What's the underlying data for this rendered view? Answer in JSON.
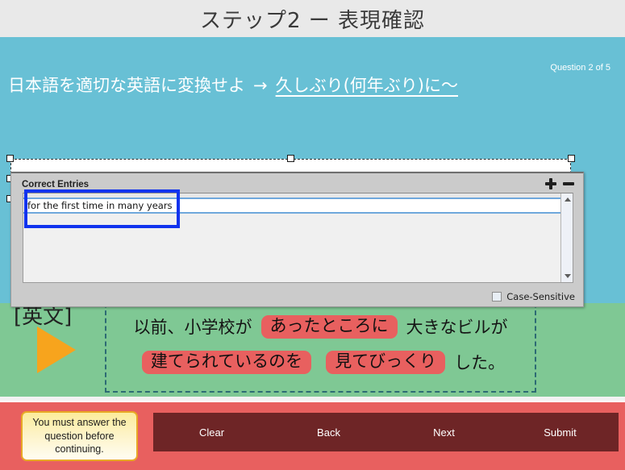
{
  "app": {
    "title": "ステップ2 ー 表現確認"
  },
  "question": {
    "counter": "Question 2 of 5",
    "instruction": "日本語を適切な英語に変換せよ",
    "arrow": "→",
    "target_phrase": "久しぶり(何年ぶり)に〜",
    "answer_value": "",
    "answer_placeholder": ""
  },
  "dialog": {
    "title": "Correct Entries",
    "add_label": "+",
    "remove_label": "−",
    "entries": [
      "for the first time in many years"
    ],
    "case_sensitive_label": "Case-Sensitive",
    "case_sensitive_checked": false,
    "scroll_up_icon": "triangle-up",
    "scroll_down_icon": "triangle-down"
  },
  "annotation": {
    "highlight_color": "#1133ee"
  },
  "sentence_panel": {
    "label": "[英文]",
    "play_icon": "play-triangle",
    "line1": [
      {
        "text": "以前、小学校が",
        "token": false
      },
      {
        "text": "あったところに",
        "token": true
      },
      {
        "text": "大きなビルが",
        "token": false
      }
    ],
    "line2": [
      {
        "text": "建てられているのを",
        "token": true
      },
      {
        "text": "見てびっくり",
        "token": true
      },
      {
        "text": "した。",
        "token": false
      }
    ]
  },
  "footer": {
    "tooltip": "You must answer the question before continuing.",
    "buttons": [
      {
        "label": "Clear"
      },
      {
        "label": "Back"
      },
      {
        "label": "Next"
      },
      {
        "label": "Submit"
      }
    ]
  },
  "colors": {
    "title_bar": "#e9e9e9",
    "teal_panel": "#68c0d5",
    "green_panel": "#7fc894",
    "accent_red": "#e8605f",
    "button_dark": "#6e2526",
    "token_red": "#e8605f",
    "play_orange": "#f7a41d",
    "annotation_blue": "#1133ee",
    "tooltip_border": "#e8a825"
  }
}
